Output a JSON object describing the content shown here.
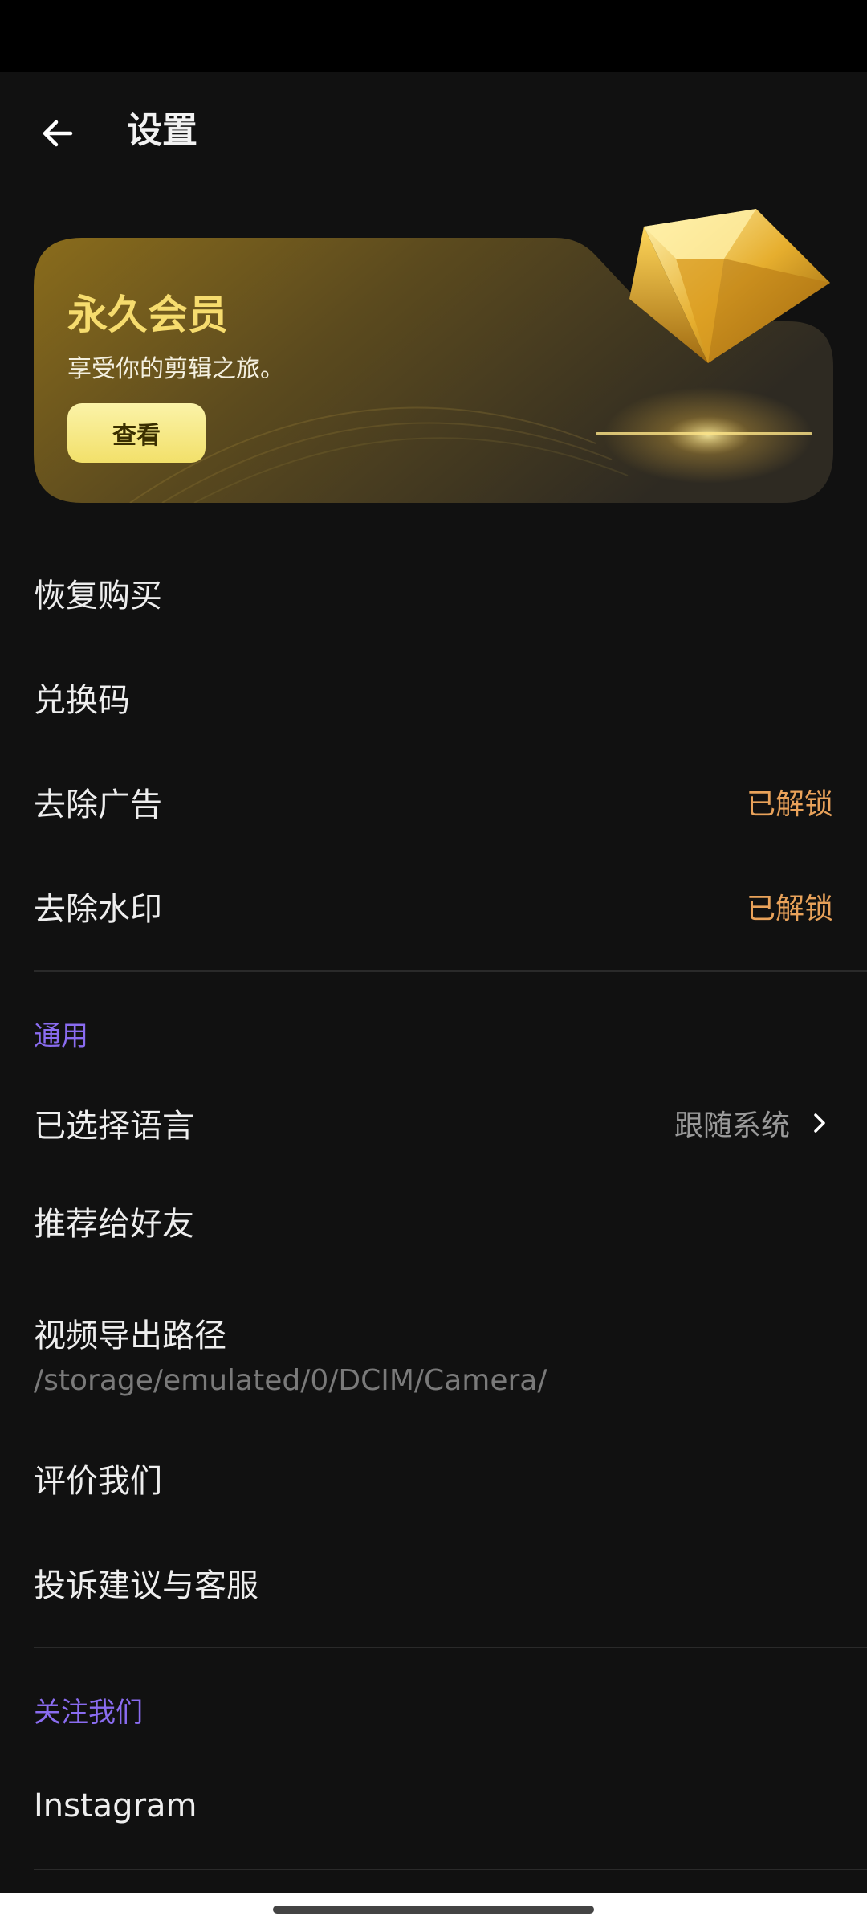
{
  "header": {
    "title": "设置"
  },
  "member_card": {
    "title": "永久会员",
    "subtitle": "享受你的剪辑之旅。",
    "view_label": "查看"
  },
  "purchase_items": [
    {
      "label": "恢复购买"
    },
    {
      "label": "兑换码"
    },
    {
      "label": "去除广告",
      "value": "已解锁"
    },
    {
      "label": "去除水印",
      "value": "已解锁"
    }
  ],
  "general": {
    "header": "通用",
    "language": {
      "label": "已选择语言",
      "value": "跟随系统"
    },
    "recommend": {
      "label": "推荐给好友"
    },
    "export_path": {
      "label": "视频导出路径",
      "value": "/storage/emulated/0/DCIM/Camera/"
    },
    "rate": {
      "label": "评价我们"
    },
    "feedback": {
      "label": "投诉建议与客服"
    }
  },
  "follow": {
    "header": "关注我们",
    "instagram": {
      "label": "Instagram"
    }
  },
  "colors": {
    "accent_purple": "#8a6cf0",
    "unlocked_orange": "#e9a25a",
    "gold": "#f6dc6e"
  }
}
